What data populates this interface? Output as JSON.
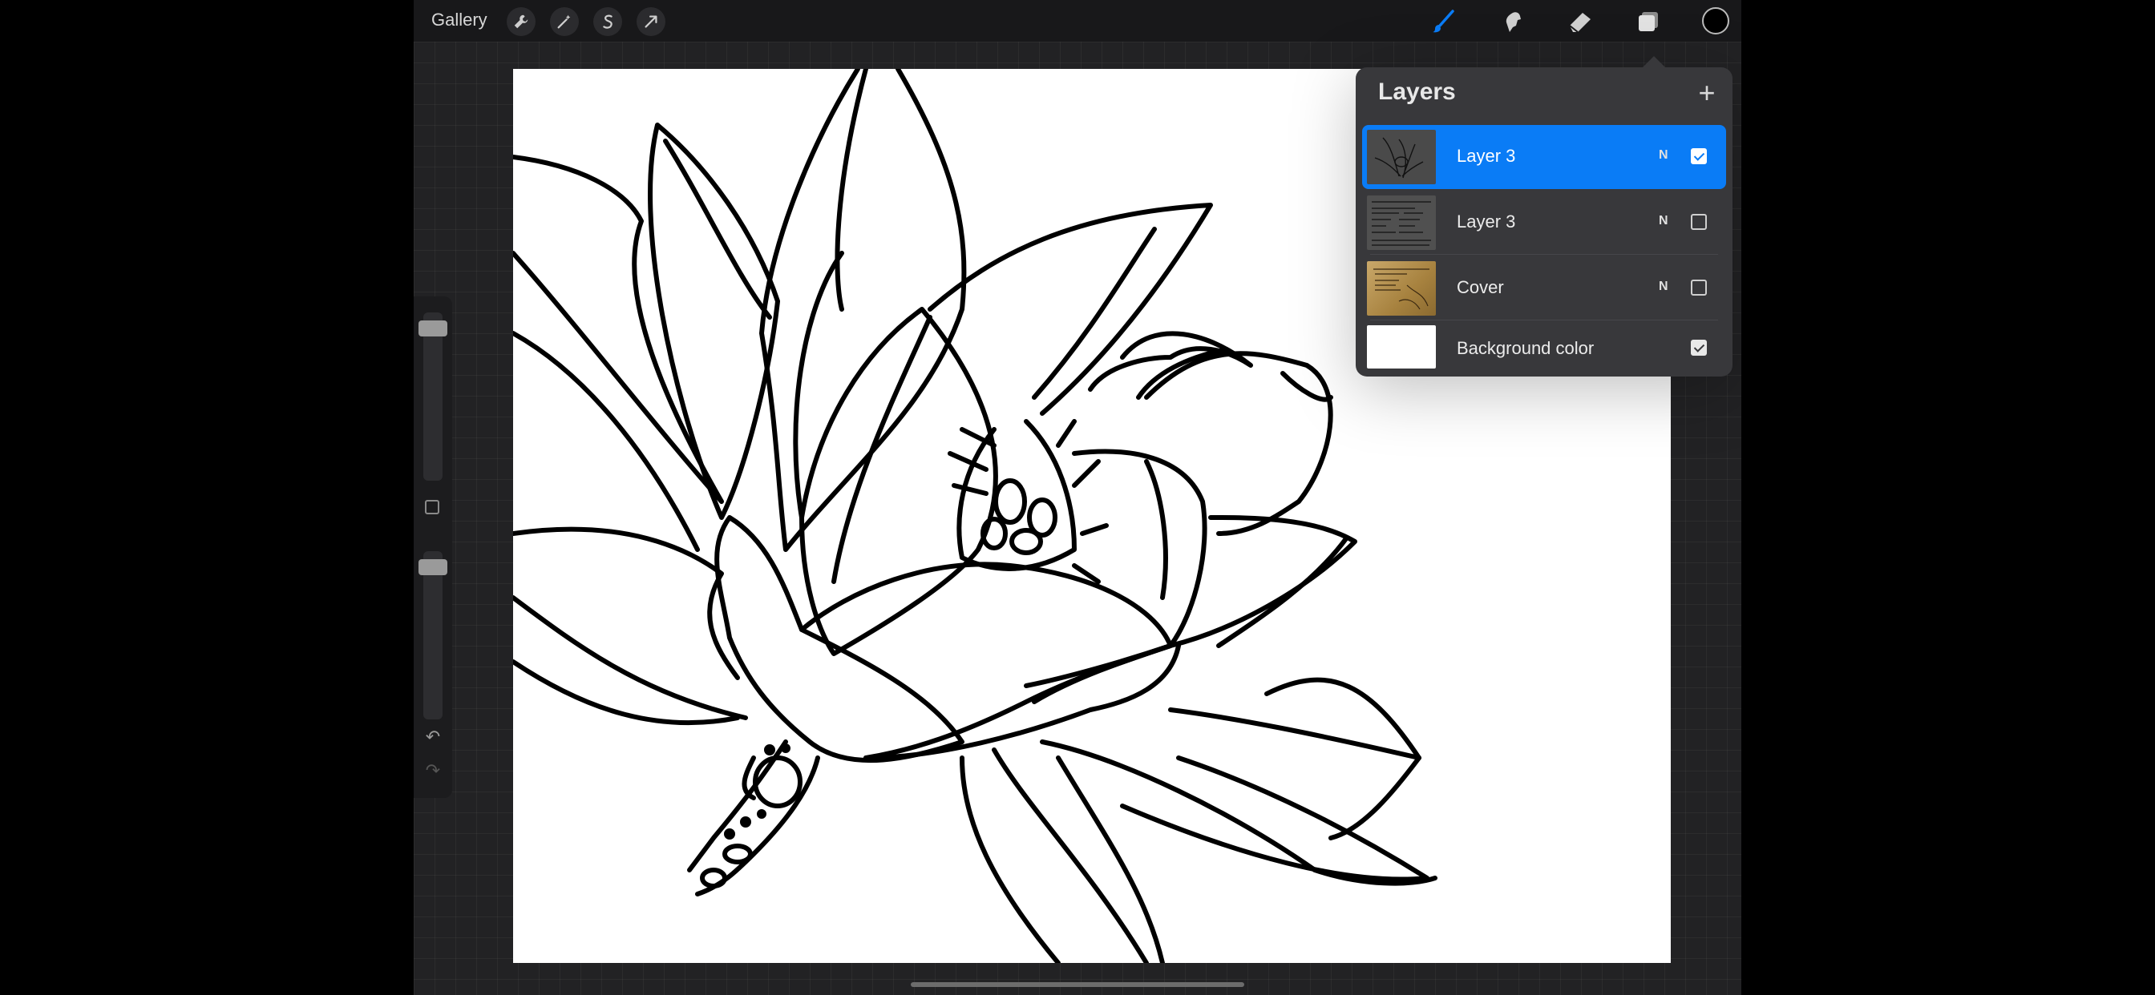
{
  "toolbar": {
    "gallery_label": "Gallery",
    "left_tools": [
      "wrench-icon",
      "magic-wand-icon",
      "selection-s-icon",
      "transform-arrow-icon"
    ],
    "right_tools": [
      "brush-icon",
      "smudge-icon",
      "eraser-icon",
      "layers-icon"
    ],
    "active_tool": "brush-icon",
    "current_color": "#000000"
  },
  "sidebar": {
    "brush_size_level": 0.05,
    "opacity_level": 0.05,
    "controls": [
      "modify-button",
      "undo-icon",
      "redo-icon"
    ]
  },
  "layers_panel": {
    "title": "Layers",
    "add_icon": "plus-icon",
    "layers": [
      {
        "name": "Layer 3",
        "blend": "N",
        "visible": true,
        "selected": true,
        "thumbnail": "lotus line art"
      },
      {
        "name": "Layer 3",
        "blend": "N",
        "visible": false,
        "selected": false,
        "thumbnail": "text document"
      },
      {
        "name": "Cover",
        "blend": "N",
        "visible": false,
        "selected": false,
        "thumbnail": "parchment cover"
      },
      {
        "name": "Background color",
        "blend": "",
        "visible": true,
        "selected": false,
        "thumbnail": "white"
      }
    ]
  },
  "colors": {
    "accent": "#0a7cf6",
    "panel_bg": "#38383b",
    "app_bg": "#222224",
    "canvas_bg": "#ffffff"
  }
}
